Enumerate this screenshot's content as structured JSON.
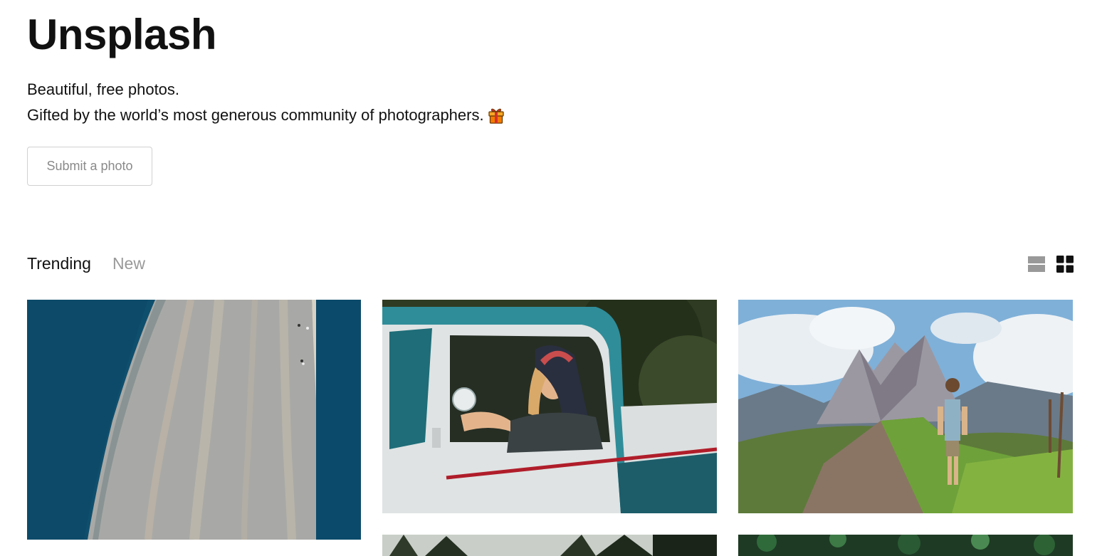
{
  "header": {
    "brand": "Unsplash",
    "tagline_line1": "Beautiful, free photos.",
    "tagline_line2": "Gifted by the world’s most generous community of photographers.",
    "gift_icon": "gift-icon",
    "submit_label": "Submit a photo"
  },
  "feed": {
    "tabs": [
      {
        "label": "Trending",
        "active": true
      },
      {
        "label": "New",
        "active": false
      }
    ],
    "view_modes": [
      {
        "icon": "list-view-icon",
        "active": false
      },
      {
        "icon": "grid-view-icon",
        "active": true
      }
    ]
  },
  "photos": [
    {
      "name": "photo-aerial-beach",
      "description_icon": "image"
    },
    {
      "name": "photo-woman-in-truck",
      "description_icon": "image"
    },
    {
      "name": "photo-mountain-hiker",
      "description_icon": "image"
    },
    {
      "name": "photo-forest-trees",
      "description_icon": "image"
    },
    {
      "name": "photo-green-foliage",
      "description_icon": "image"
    }
  ],
  "colors": {
    "text": "#111111",
    "muted": "#999999",
    "border": "#d1d1d1",
    "icon_inactive": "#999999",
    "icon_active": "#111111"
  }
}
